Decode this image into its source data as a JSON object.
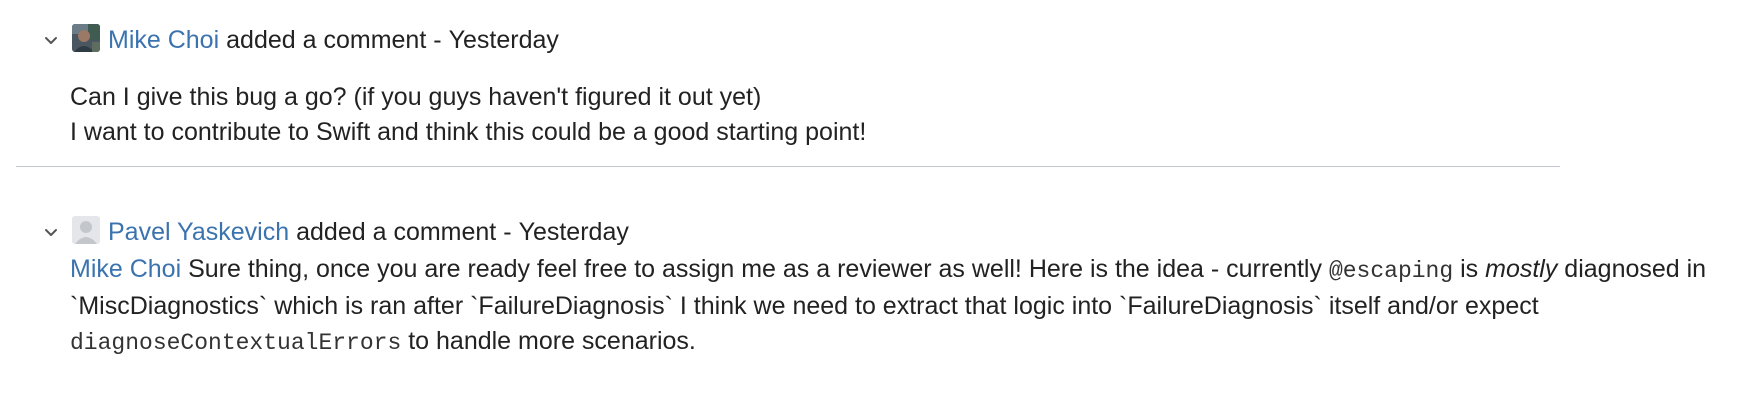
{
  "comments": [
    {
      "author": "Mike Choi",
      "action": "added a comment",
      "separator": "-",
      "time": "Yesterday",
      "avatar_icon": "user-photo-icon",
      "paragraphs": [
        "Can I give this bug a go? (if you guys haven't figured it out yet)",
        "I want to contribute to Swift and think this could be a good starting point!"
      ]
    },
    {
      "author": "Pavel Yaskevich",
      "action": "added a comment",
      "separator": "-",
      "time": "Yesterday",
      "avatar_icon": "default-avatar-icon",
      "body": {
        "mention": "Mike Choi",
        "text_1": " Sure thing, once you are ready feel free to assign me as a reviewer as well! Here is the idea - currently ",
        "code_1": "@escaping",
        "text_2": " is ",
        "emphasis": "mostly",
        "text_3": " diagnosed in `MiscDiagnostics` which is ran after `FailureDiagnosis` I think we need to extract that logic into `FailureDiagnosis` itself and/or expect ",
        "code_2": "diagnoseContextualErrors",
        "text_4": " to handle more scenarios."
      }
    }
  ],
  "colors": {
    "link": "#3b73af",
    "text": "#222222",
    "divider": "#c1c7d0"
  }
}
